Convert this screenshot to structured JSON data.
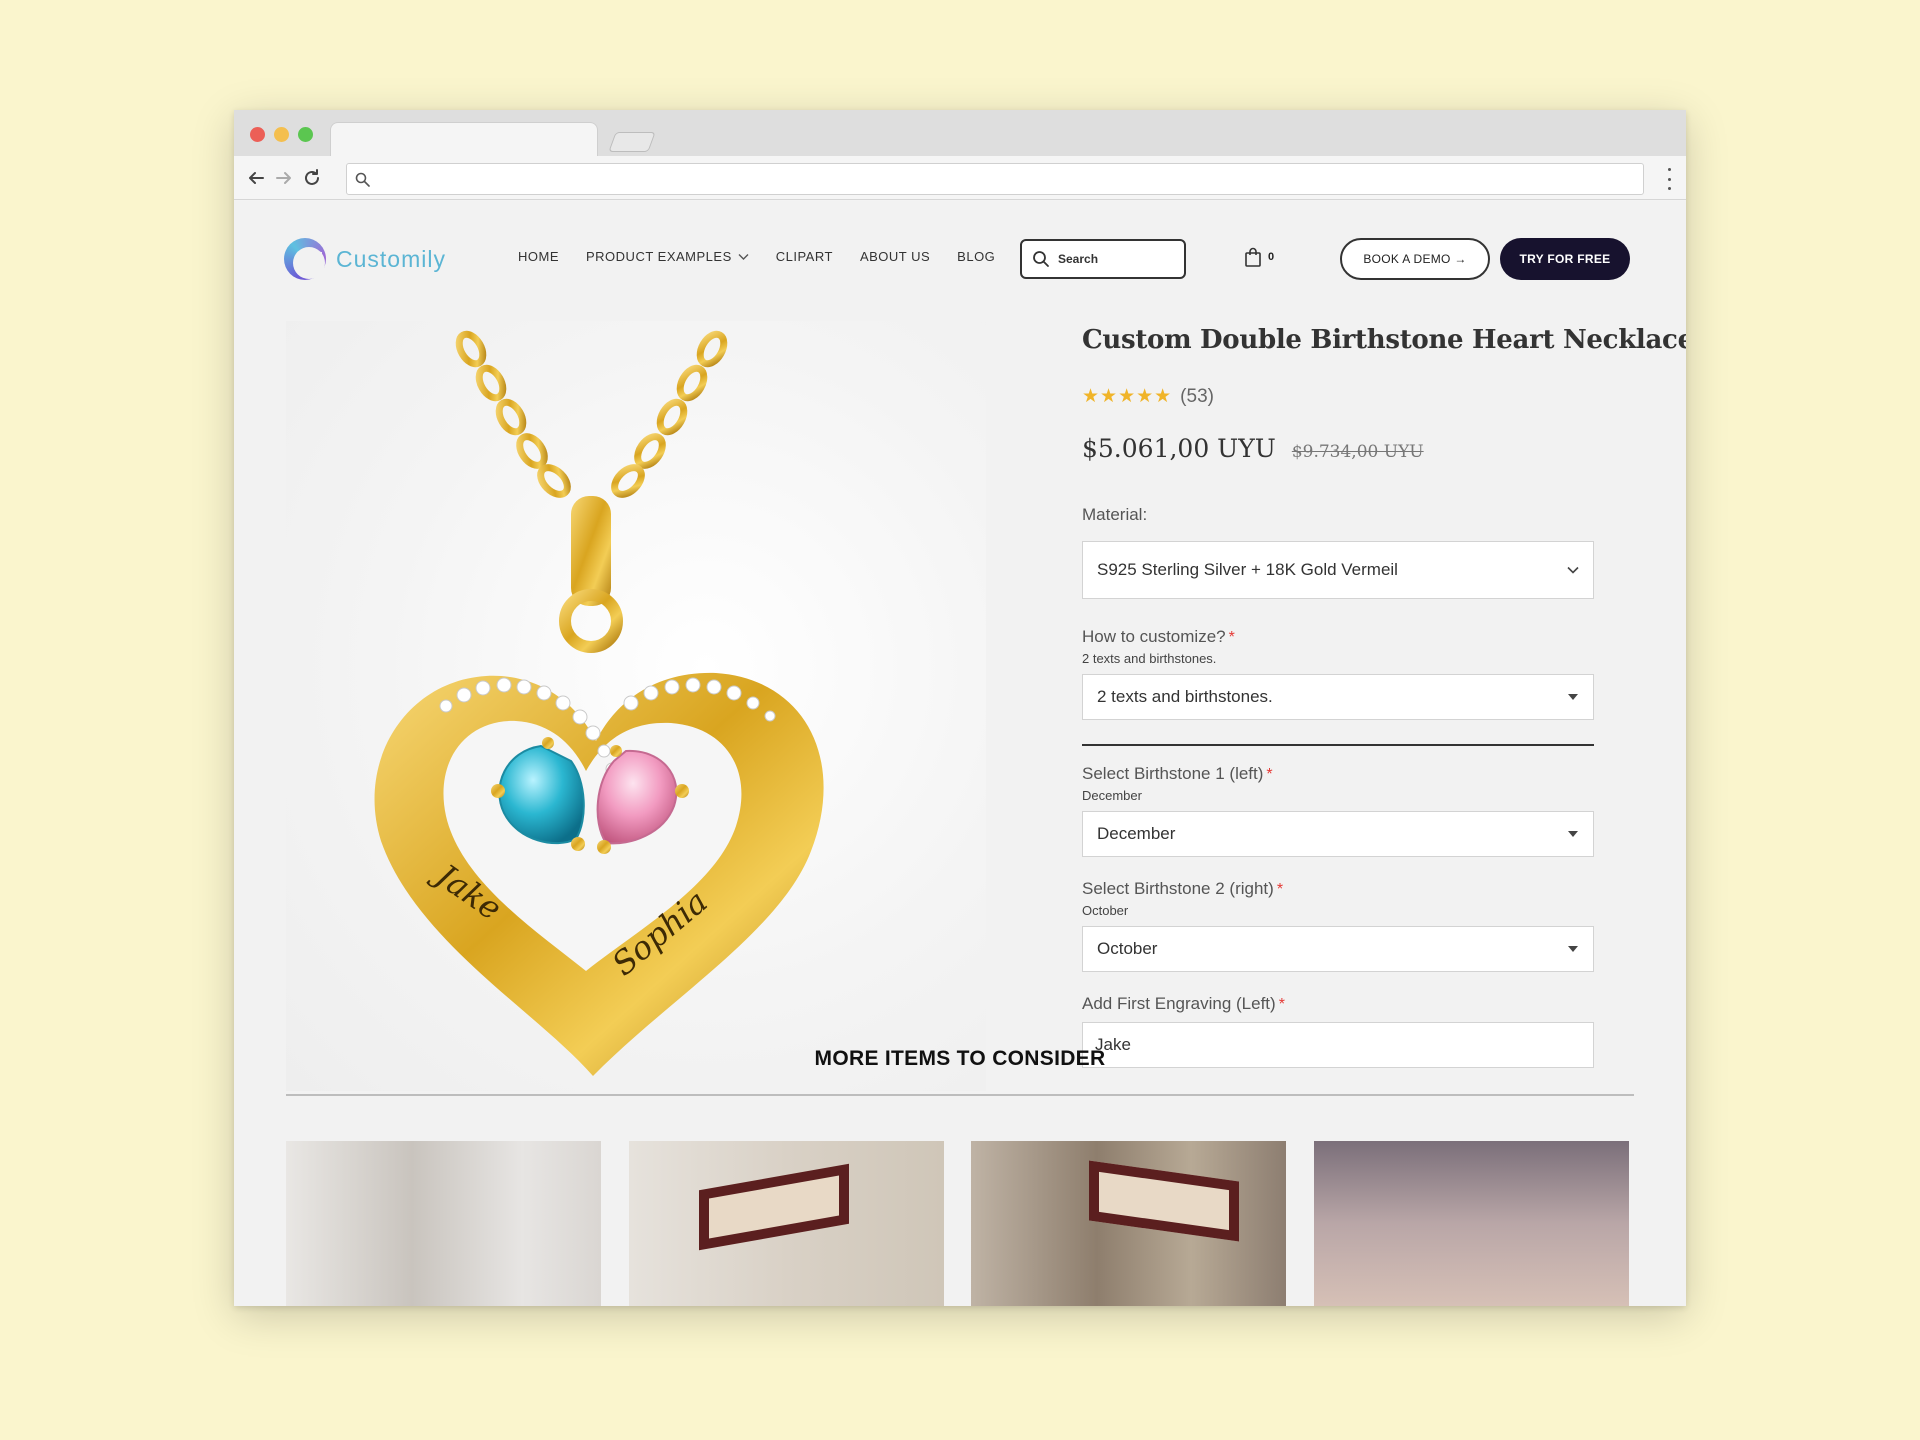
{
  "browser": {
    "address": ""
  },
  "brand": {
    "name": "Customily",
    "accent": "#5bb5d4",
    "dark": "#17122e"
  },
  "nav": {
    "items": [
      {
        "label": "HOME"
      },
      {
        "label": "PRODUCT EXAMPLES"
      },
      {
        "label": "CLIPART"
      },
      {
        "label": "ABOUT US"
      },
      {
        "label": "BLOG"
      }
    ],
    "search_label": "Search",
    "cart_count": "0",
    "book_demo": "BOOK A DEMO →",
    "try_free": "TRY FOR FREE"
  },
  "product": {
    "title": "Custom Double Birthstone Heart Necklace",
    "stars": "★★★★★",
    "rating": 5,
    "review_count": "(53)",
    "price": "$5.061,00 UYU",
    "compare_price": "$9.734,00 UYU",
    "engraving_left": "Jake",
    "engraving_right": "Sophia",
    "stone_colors": {
      "left": "#2bb7d1",
      "right": "#f29bc1"
    }
  },
  "options": {
    "material": {
      "label": "Material:",
      "value": "S925 Sterling Silver + 18K Gold Vermeil"
    },
    "customize": {
      "label": "How to customize?",
      "required": "*",
      "current": "2 texts and birthstones.",
      "value": "2 texts and birthstones."
    },
    "birthstone1": {
      "label": "Select Birthstone 1 (left)",
      "required": "*",
      "current": "December",
      "value": "December"
    },
    "birthstone2": {
      "label": "Select Birthstone 2 (right)",
      "required": "*",
      "current": "October",
      "value": "October"
    },
    "engraving1": {
      "label": "Add First Engraving (Left)",
      "required": "*",
      "value": "Jake"
    }
  },
  "more": {
    "title": "MORE ITEMS TO CONSIDER"
  }
}
